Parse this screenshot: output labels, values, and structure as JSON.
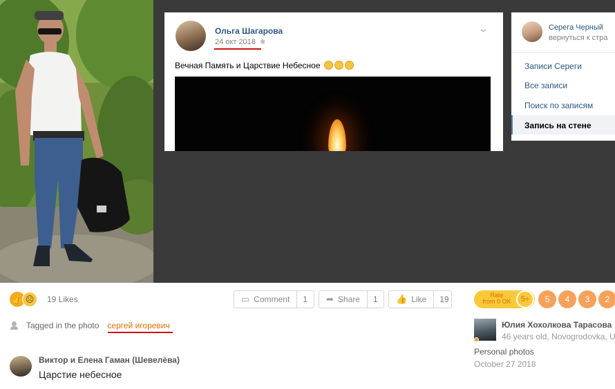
{
  "vk_post": {
    "author": "Ольга Шагарова",
    "date": "24 окт 2018",
    "text": "Вечная Память и Царствие Небесное"
  },
  "vk_menu": {
    "profile_name": "Серега Черный",
    "profile_sub": "вернуться к стра",
    "items": [
      {
        "label": "Записи Сереги"
      },
      {
        "label": "Все записи"
      },
      {
        "label": "Поиск по записям"
      },
      {
        "label": "Запись на стене"
      }
    ]
  },
  "reactions": {
    "likes_text": "19 Likes",
    "like_icon": "thumbs-up-icon",
    "sad_icon": "sad-face-icon"
  },
  "actions": {
    "comment_label": "Comment",
    "comment_count": "1",
    "share_label": "Share",
    "share_count": "1",
    "like_label": "Like",
    "like_count": "19"
  },
  "rating": {
    "rate_line1": "Rate",
    "rate_line2": "from 0 OK",
    "five_plus": "5+",
    "values": [
      "5",
      "4",
      "3",
      "2"
    ]
  },
  "tag": {
    "label": "Tagged in the photo",
    "name": "сергей игоревич"
  },
  "comment": {
    "author": "Виктор и Елена Гаман (Шевелёва)",
    "text": "Царстие небесное"
  },
  "owner": {
    "name": "Юлия Хохолкова Тарасова",
    "info": "46 years old, Novogrodovka, U"
  },
  "album": {
    "name": "Personal photos",
    "date": "October 27 2018"
  },
  "colors": {
    "vk_link": "#2a5885",
    "ok_orange": "#e07000",
    "highlight_red": "#cc1111"
  }
}
